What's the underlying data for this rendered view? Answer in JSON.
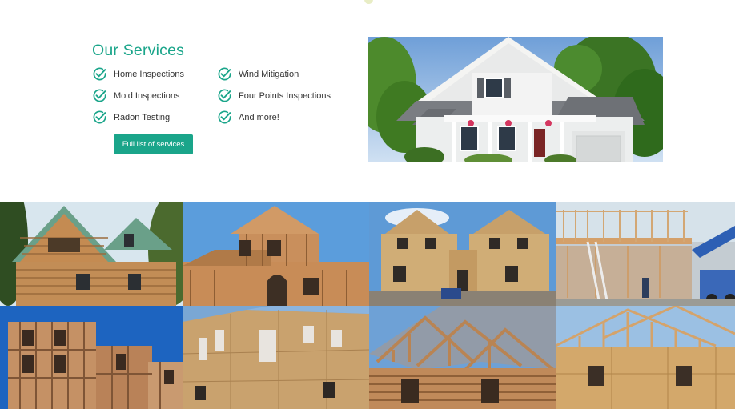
{
  "services": {
    "title": "Our Services",
    "items": [
      {
        "label": "Home Inspections"
      },
      {
        "label": "Mold Inspections"
      },
      {
        "label": "Radon Testing"
      },
      {
        "label": "Wind Mitigation"
      },
      {
        "label": "Four Points Inspections"
      },
      {
        "label": "And more!"
      }
    ],
    "button_label": "Full list of services",
    "check_icon": "check-circle-icon",
    "accent_color": "#1aa58a"
  },
  "gallery": {
    "photos": [
      {
        "subject": "log-cabin-house"
      },
      {
        "subject": "wood-frame-house-construction"
      },
      {
        "subject": "osb-sheathed-houses"
      },
      {
        "subject": "wood-framing-with-crane-and-workers"
      },
      {
        "subject": "multi-story-framing-under-blue-sky"
      },
      {
        "subject": "osb-sheathed-building"
      },
      {
        "subject": "log-house-with-roof-trusses"
      },
      {
        "subject": "osb-wall-with-roof-framing"
      }
    ]
  }
}
